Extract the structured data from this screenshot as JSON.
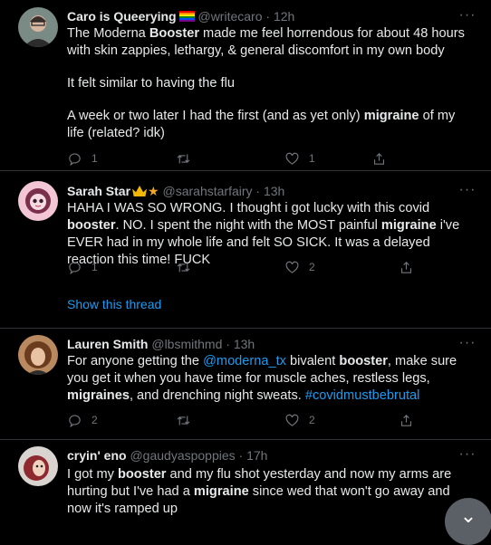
{
  "tweets": [
    {
      "name": "Caro is Queerying",
      "handle": "@writecaro",
      "time": "12h",
      "paragraphs": [
        [
          {
            "t": "The Moderna "
          },
          {
            "t": "Booster",
            "hl": true
          },
          {
            "t": " made me feel horrendous for about 48 hours with skin zappies, lethargy, & general discomfort in my own body"
          }
        ],
        [
          {
            "t": "It felt similar to having the flu"
          }
        ],
        [
          {
            "t": "A week or two later I had the first (and as yet only) "
          },
          {
            "t": "migraine",
            "hl": true
          },
          {
            "t": " of my life (related? idk)"
          }
        ]
      ],
      "reply_count": "1",
      "retweet_count": "",
      "like_count": "1"
    },
    {
      "name": "Sarah Star",
      "handle": "@sarahstarfairy",
      "time": "13h",
      "paragraphs": [
        [
          {
            "t": "HAHA I WAS SO WRONG. I thought i got lucky with this covid "
          },
          {
            "t": "booster",
            "hl": true
          },
          {
            "t": ". NO. I spent the night with the MOST painful "
          },
          {
            "t": "migraine",
            "hl": true
          },
          {
            "t": " i've EVER had in my whole life and felt SO SICK. It was a delayed reaction this time! FUCK"
          }
        ]
      ],
      "reply_count": "1",
      "retweet_count": "",
      "like_count": "2",
      "show_thread": "Show this thread"
    },
    {
      "name": "Lauren Smith",
      "handle": "@lbsmithmd",
      "time": "13h",
      "paragraphs": [
        [
          {
            "t": "For anyone getting the "
          },
          {
            "t": "@moderna_tx",
            "link": true
          },
          {
            "t": " bivalent "
          },
          {
            "t": "booster",
            "hl": true
          },
          {
            "t": ", make sure you get it when you have time for muscle aches, restless legs, "
          },
          {
            "t": "migraines",
            "hl": true
          },
          {
            "t": ", and drenching night sweats. "
          },
          {
            "t": "#covidmustbebrutal",
            "link": true
          }
        ]
      ],
      "reply_count": "2",
      "retweet_count": "",
      "like_count": "2"
    },
    {
      "name": "cryin' eno",
      "handle": "@gaudyaspoppies",
      "time": "17h",
      "paragraphs": [
        [
          {
            "t": "I got my "
          },
          {
            "t": "booster",
            "hl": true
          },
          {
            "t": " and my flu shot yesterday and now my arms are  hurting but I've had a "
          },
          {
            "t": "migraine",
            "hl": true
          },
          {
            "t": " since wed that won't go away and now it's ramped up"
          }
        ]
      ]
    }
  ],
  "separator": "·",
  "more_glyph": "···",
  "fab_glyph": "⌄",
  "colors": {
    "accent": "#1d9bf0",
    "muted": "#71767b",
    "background": "#000000",
    "text": "#e7e9ea"
  }
}
